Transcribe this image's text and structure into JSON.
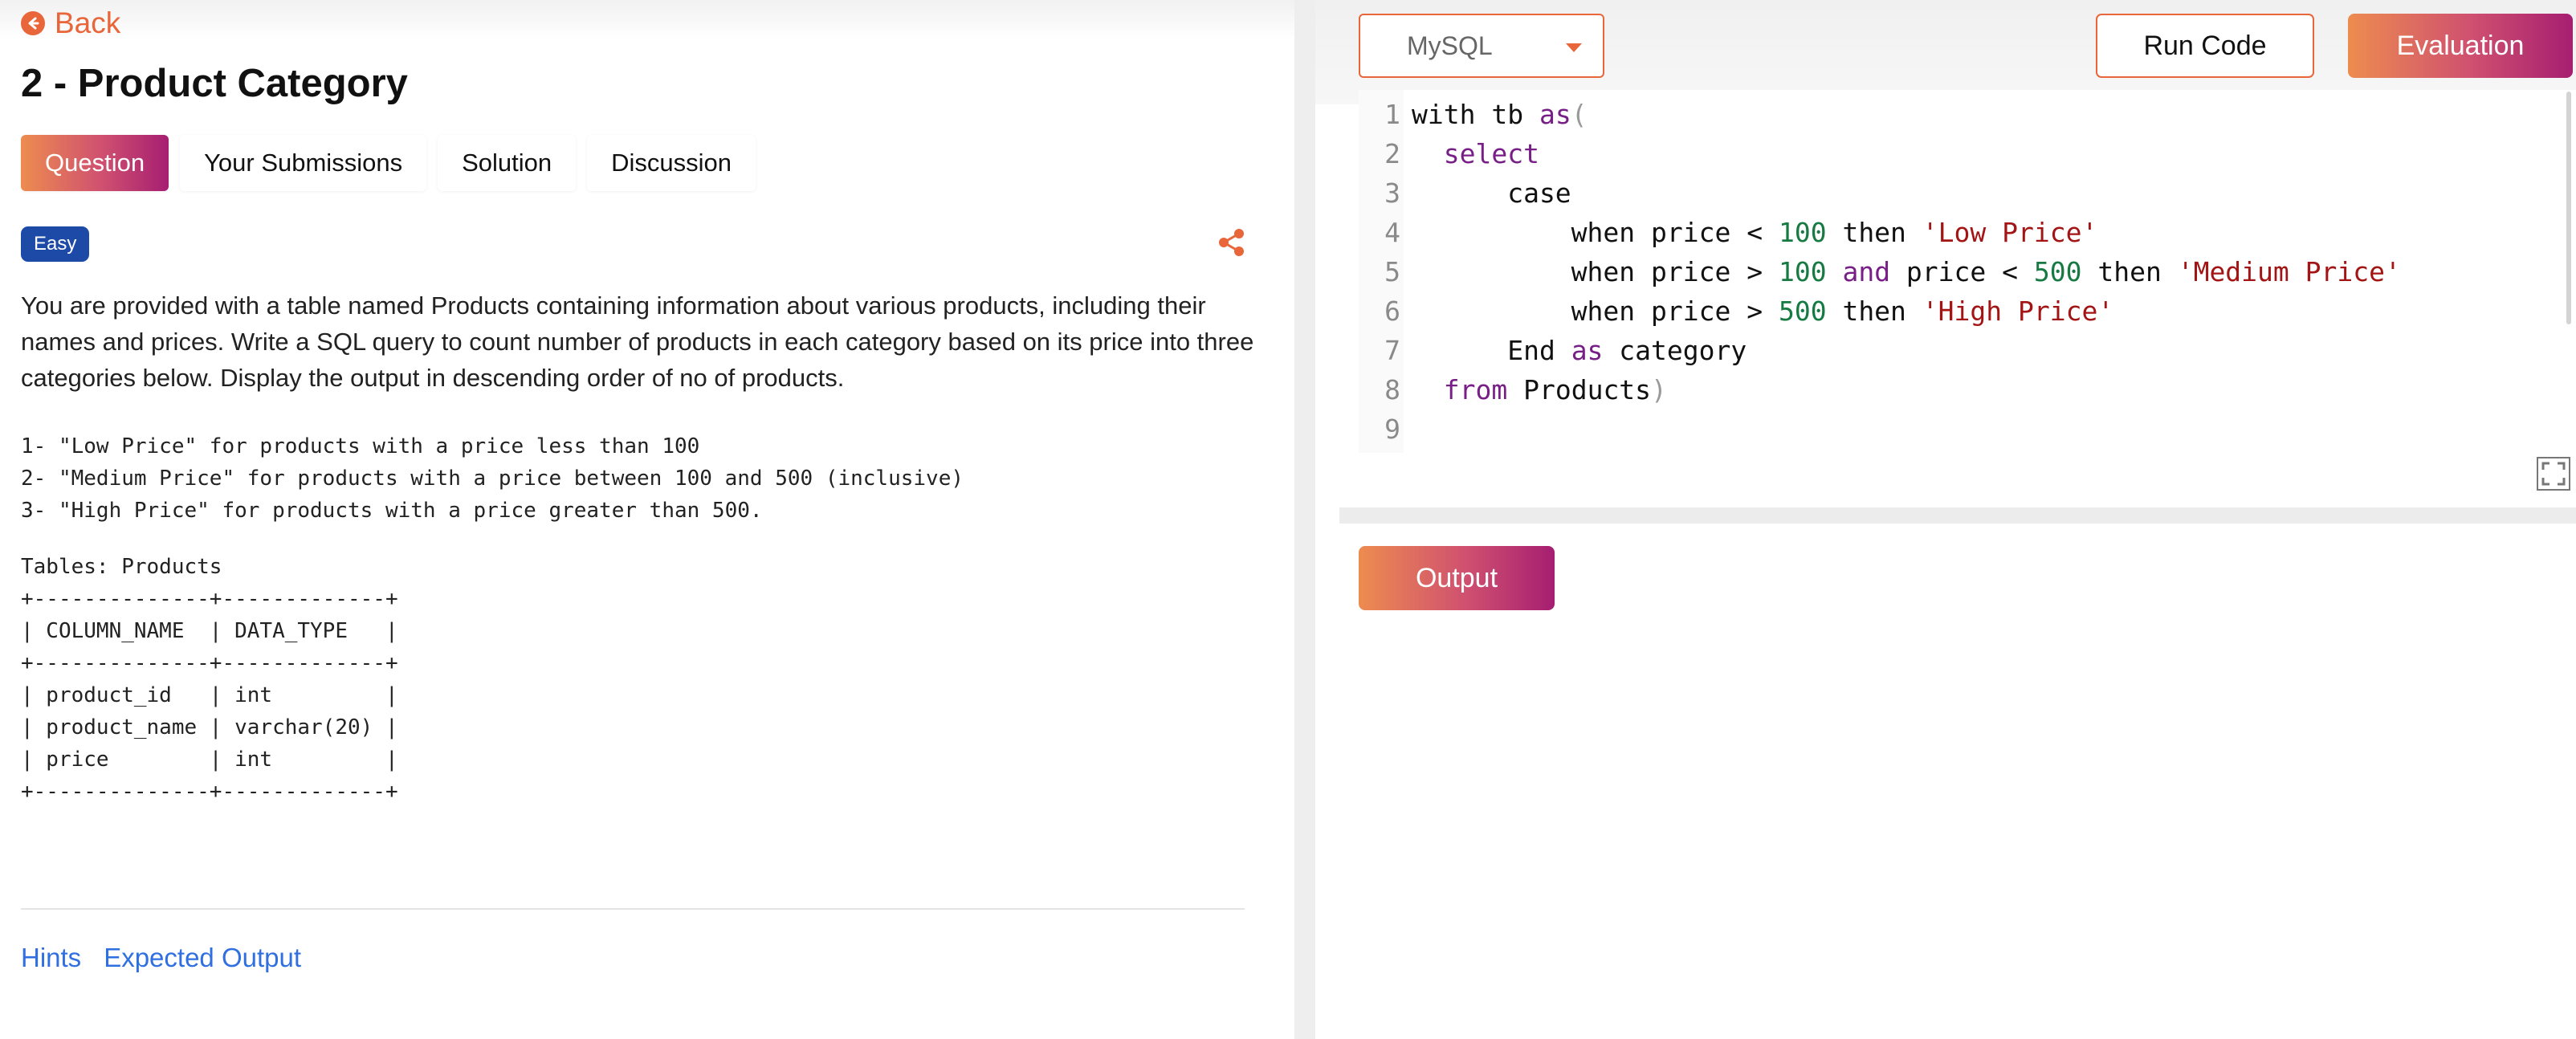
{
  "nav": {
    "back_label": "Back"
  },
  "problem": {
    "title": "2 - Product Category",
    "difficulty": "Easy",
    "description": "You are provided with a table named Products containing information about various products, including their names and prices. Write a SQL query to count number of products in each category based on its price into three categories below. Display the output in descending order of no of products.",
    "rules": "1- \"Low Price\" for products with a price less than 100\n2- \"Medium Price\" for products with a price between 100 and 500 (inclusive)\n3- \"High Price\" for products with a price greater than 500.",
    "tables_label": "Tables: Products",
    "schema_table": "+--------------+-------------+\n| COLUMN_NAME  | DATA_TYPE   |\n+--------------+-------------+\n| product_id   | int         |\n| product_name | varchar(20) |\n| price        | int         |\n+--------------+-------------+"
  },
  "tabs": [
    {
      "label": "Question",
      "active": true
    },
    {
      "label": "Your Submissions",
      "active": false
    },
    {
      "label": "Solution",
      "active": false
    },
    {
      "label": "Discussion",
      "active": false
    }
  ],
  "footer_links": {
    "hints": "Hints",
    "expected_output": "Expected Output"
  },
  "editor": {
    "language": "MySQL",
    "run_label": "Run Code",
    "eval_label": "Evaluation",
    "output_label": "Output",
    "line_numbers": [
      "1",
      "2",
      "3",
      "4",
      "5",
      "6",
      "7",
      "8",
      "9"
    ],
    "code_lines": [
      "with tb as(",
      "  select",
      "      case",
      "          when price < 100 then 'Low Price'",
      "          when price > 100 and price < 500 then 'Medium Price'",
      "          when price > 500 then 'High Price'",
      "      End as category",
      "  from Products)",
      ""
    ]
  },
  "colors": {
    "accent": "#e8663a",
    "gradient_start": "#ed8c4f",
    "gradient_end": "#a61e71",
    "badge_blue": "#1d4aa6",
    "link_blue": "#2f6fe0",
    "keyword": "#771f86",
    "number": "#167a42",
    "string": "#a31515"
  },
  "icons": [
    "arrow-left-circle-icon",
    "share-icon",
    "chevron-down-icon",
    "fullscreen-icon"
  ]
}
